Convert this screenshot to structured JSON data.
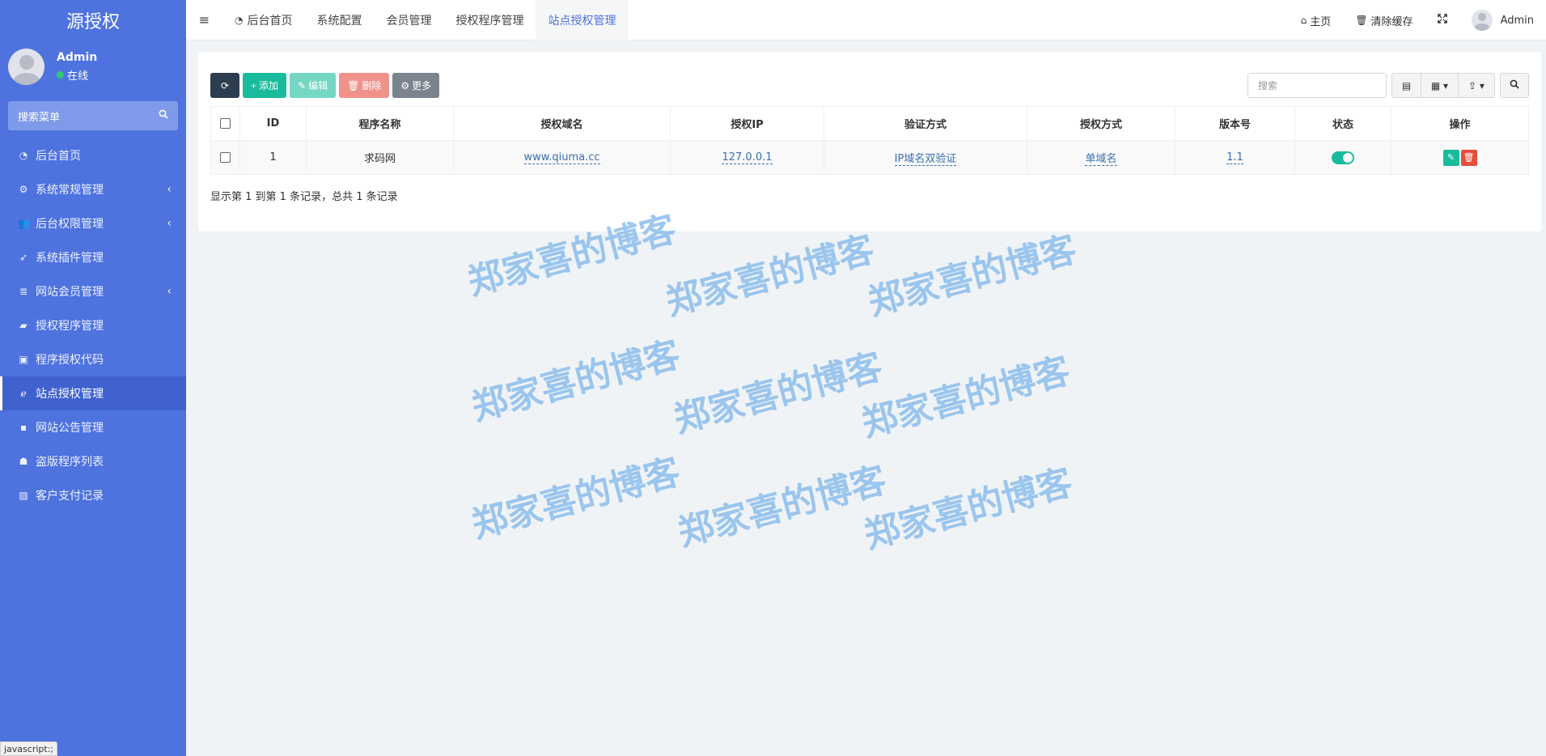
{
  "app": {
    "brand": "源授权"
  },
  "user": {
    "name": "Admin",
    "status": "在线"
  },
  "sidebar": {
    "search_label": "搜索菜单",
    "items": [
      {
        "label": "后台首页",
        "icon": "dashboard-icon",
        "glyph": "◔",
        "has_arrow": false
      },
      {
        "label": "系统常规管理",
        "icon": "cogs-icon",
        "glyph": "⚙",
        "has_arrow": true
      },
      {
        "label": "后台权限管理",
        "icon": "users-icon",
        "glyph": "👥",
        "has_arrow": true
      },
      {
        "label": "系统插件管理",
        "icon": "rocket-icon",
        "glyph": "➶",
        "has_arrow": false
      },
      {
        "label": "网站会员管理",
        "icon": "list-icon",
        "glyph": "≣",
        "has_arrow": true
      },
      {
        "label": "授权程序管理",
        "icon": "car-icon",
        "glyph": "▰",
        "has_arrow": false
      },
      {
        "label": "程序授权代码",
        "icon": "id-card-icon",
        "glyph": "▣",
        "has_arrow": false
      },
      {
        "label": "站点授权管理",
        "icon": "ie-icon",
        "glyph": "ℯ",
        "has_arrow": false,
        "active": true
      },
      {
        "label": "网站公告管理",
        "icon": "bullhorn-icon",
        "glyph": "▪",
        "has_arrow": false
      },
      {
        "label": "盗版程序列表",
        "icon": "user-secret-icon",
        "glyph": "☗",
        "has_arrow": false
      },
      {
        "label": "客户支付记录",
        "icon": "picture-icon",
        "glyph": "▨",
        "has_arrow": false
      }
    ]
  },
  "navbar": {
    "tabs": [
      {
        "label": "后台首页",
        "icon": "dashboard-icon"
      },
      {
        "label": "系统配置"
      },
      {
        "label": "会员管理"
      },
      {
        "label": "授权程序管理"
      },
      {
        "label": "站点授权管理",
        "active": true
      }
    ],
    "home_label": "主页",
    "clear_cache_label": "清除缓存",
    "admin_label": "Admin"
  },
  "toolbar": {
    "add": "添加",
    "edit": "编辑",
    "delete": "删除",
    "more": "更多",
    "search_placeholder": "搜索"
  },
  "table": {
    "headers": [
      "ID",
      "程序名称",
      "授权域名",
      "授权IP",
      "验证方式",
      "授权方式",
      "版本号",
      "状态",
      "操作"
    ],
    "rows": [
      {
        "id": "1",
        "program": "求码网",
        "domain": "www.qiuma.cc",
        "ip": "127.0.0.1",
        "verify": "IP域名双验证",
        "auth_type": "单域名",
        "version": "1.1",
        "status": "on"
      }
    ]
  },
  "summary": "显示第 1 到第 1 条记录，总共 1 条记录",
  "watermark": "郑家喜的博客",
  "status_bar": "javascript:;",
  "colors": {
    "sidebar": "#4e73df",
    "accent": "#18bc9c",
    "danger": "#e74c3c",
    "dark": "#2c3e50"
  }
}
